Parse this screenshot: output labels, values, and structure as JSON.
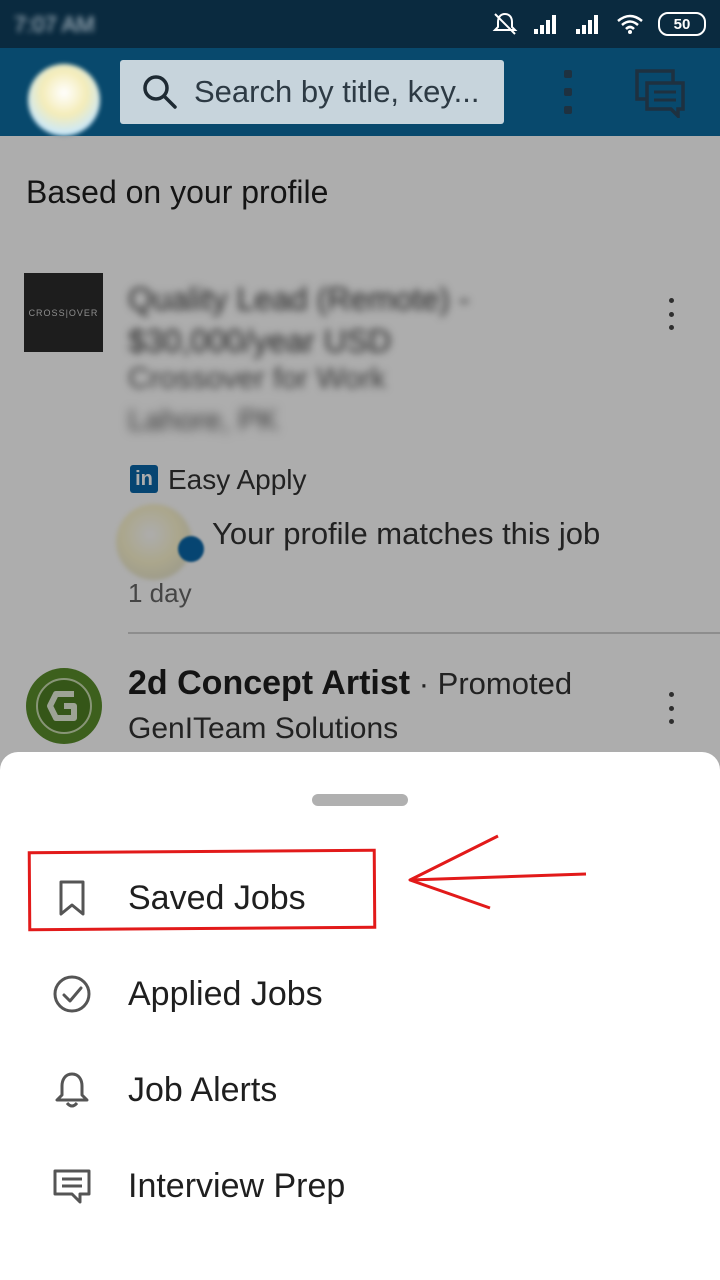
{
  "status_bar": {
    "time": "7:07 AM",
    "battery": "50",
    "icons": [
      "mute-icon",
      "signal-icon",
      "signal-icon",
      "wifi-icon",
      "battery-icon"
    ]
  },
  "app_bar": {
    "search_placeholder": "Search by title, key...",
    "icons": [
      "avatar",
      "search-icon",
      "more-vertical-icon",
      "messaging-icon"
    ]
  },
  "section": {
    "title": "Based on your profile"
  },
  "jobs": [
    {
      "logo_text": "CROSS|OVER",
      "title": "Quality Lead (Remote) - $30,000/year USD",
      "company": "Crossover for Work",
      "location": "Lahore, PK",
      "easy_apply_badge": "in",
      "easy_apply": "Easy Apply",
      "match_text": "Your profile matches this job",
      "posted": "1 day"
    },
    {
      "logo_text": "G",
      "title": "2d Concept Artist",
      "separator": " · ",
      "promoted": "Promoted",
      "company": "GenITeam Solutions"
    }
  ],
  "bottom_sheet": {
    "items": [
      {
        "label": "Saved Jobs",
        "icon": "bookmark-icon"
      },
      {
        "label": "Applied Jobs",
        "icon": "check-circle-icon"
      },
      {
        "label": "Job Alerts",
        "icon": "bell-icon"
      },
      {
        "label": "Interview Prep",
        "icon": "chat-bubble-icon"
      }
    ]
  },
  "colors": {
    "status_bar": "#0a2a3f",
    "app_bar": "#08496d",
    "annotation": "#e21a1a",
    "linkedin_blue": "#0a66a8"
  }
}
